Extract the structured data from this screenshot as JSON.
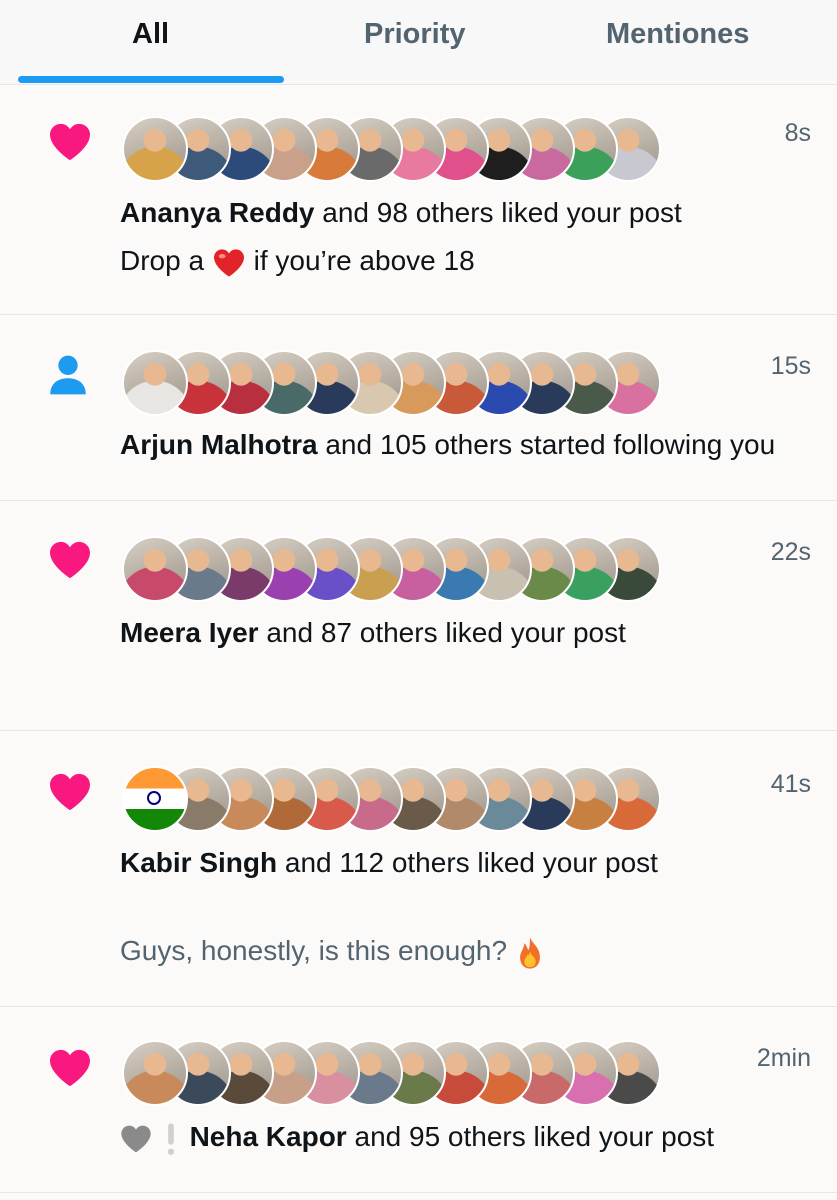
{
  "tabs": [
    {
      "label": "All",
      "active": true
    },
    {
      "label": "Priority",
      "active": false
    },
    {
      "label": "Mentiones",
      "active": false
    }
  ],
  "colors": {
    "accent": "#1d9bf0",
    "like": "#f91880",
    "follow": "#1d9bf0",
    "muted": "#536471"
  },
  "notifications": [
    {
      "type": "like",
      "icon": "heart-icon",
      "time": "8s",
      "name": "Ananya Reddy",
      "text": " and 98 others liked your post",
      "snippet_prefix": "Drop a ",
      "snippet_emoji": "red-heart-emoji",
      "snippet_suffix": " if you’re above 18",
      "avatars": [
        "#d6a24a",
        "#3e5a7a",
        "#2c4a7a",
        "#c9a08a",
        "#d87a3a",
        "#6a6a6a",
        "#e87aa0",
        "#e0508a",
        "#1e1e1e",
        "#c86aa0",
        "#3aa05a",
        "#c8c8d0"
      ]
    },
    {
      "type": "follow",
      "icon": "person-icon",
      "time": "15s",
      "name": "Arjun Malhotra",
      "text": " and 105 others started following you",
      "avatars": [
        "#e8e6e2",
        "#c8323a",
        "#b83040",
        "#4a6a6a",
        "#2a3a5a",
        "#d8c8b0",
        "#d89a5a",
        "#c85a3a",
        "#2a4ab0",
        "#2a3a5a",
        "#4a5a4a",
        "#d870a0"
      ]
    },
    {
      "type": "like",
      "icon": "heart-icon",
      "time": "22s",
      "name": "Meera Iyer",
      "text": " and 87 others liked your post",
      "avatars": [
        "#c84a6a",
        "#6a7a8a",
        "#7a3a6a",
        "#9a40b0",
        "#6a50c8",
        "#c8a050",
        "#c860a0",
        "#3a7ab0",
        "#c8c0b0",
        "#6a8a4a",
        "#3aa060",
        "#3a4a3a"
      ]
    },
    {
      "type": "like",
      "icon": "heart-icon",
      "time": "41s",
      "name": "Kabir Singh",
      "text": " and 112 others liked your post",
      "snippet": "Guys, honestly, is this enough?",
      "snippet_emoji": "fire-emoji",
      "avatars": [
        "flag",
        "#8a7a6a",
        "#c88a5a",
        "#b06a3a",
        "#d85a4a",
        "#c86a8a",
        "#6a5a4a",
        "#b08a6a",
        "#6a8a9a",
        "#2a3a5a",
        "#c88040",
        "#d86a3a"
      ]
    },
    {
      "type": "like",
      "icon": "heart-icon",
      "time": "2min",
      "name": "Neha Kapor",
      "text": " and 95 others liked your post",
      "prefix_emojis": [
        "grey-heart-emoji",
        "exclamation-emoji"
      ],
      "avatars": [
        "#c88a5a",
        "#3a4a5a",
        "#5a4a3a",
        "#c8a08a",
        "#d890a0",
        "#6a7a8a",
        "#6a7a4a",
        "#c84a3a",
        "#d86a3a",
        "#c86a6a",
        "#d870b0",
        "#4a4a4a"
      ]
    }
  ]
}
